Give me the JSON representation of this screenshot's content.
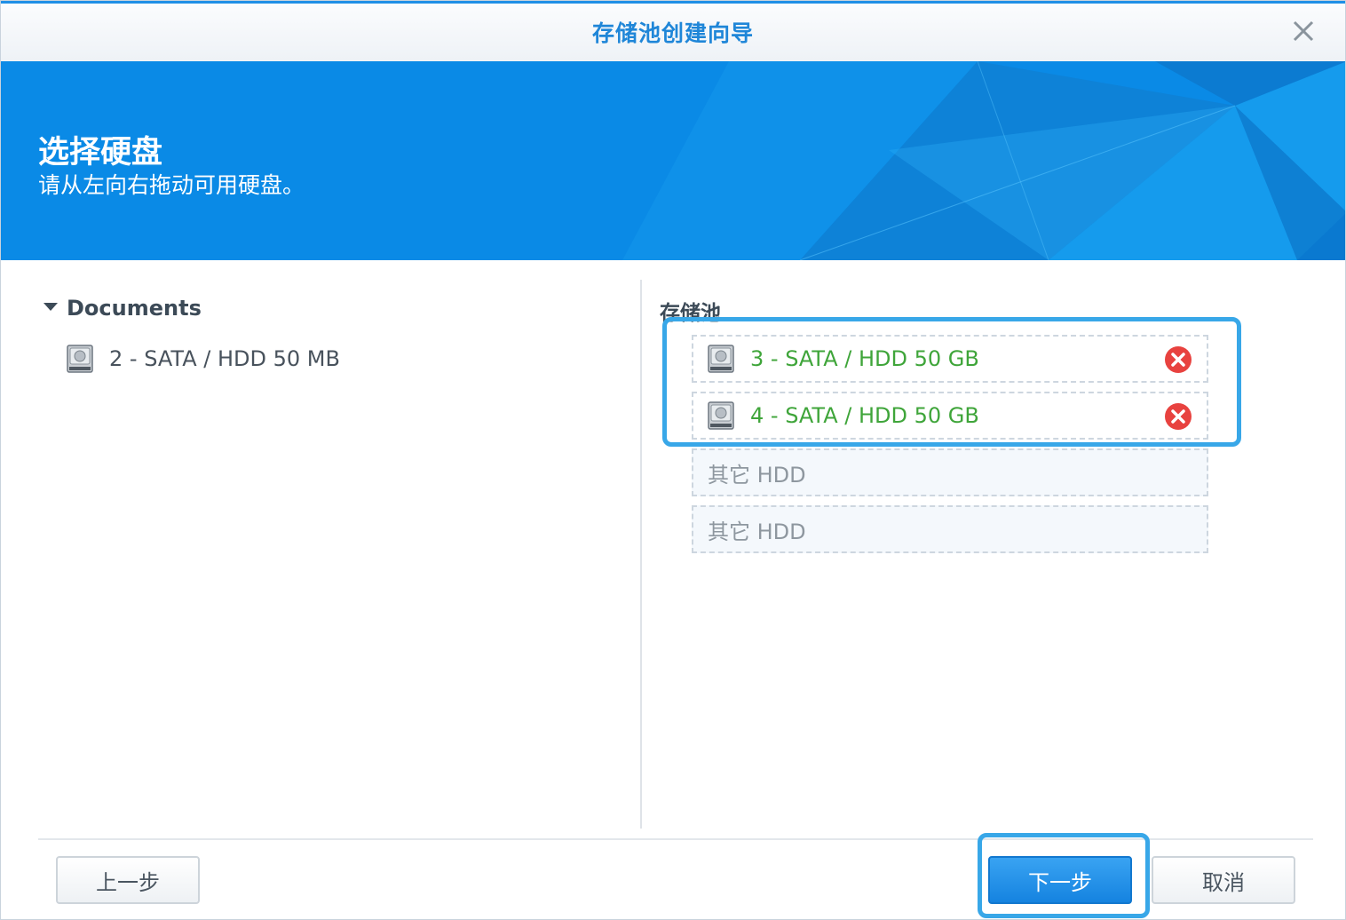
{
  "window": {
    "title": "存储池创建向导"
  },
  "banner": {
    "title": "选择硬盘",
    "subtitle": "请从左向右拖动可用硬盘。"
  },
  "available": {
    "group_name": "Documents",
    "disks": [
      {
        "label": "2 - SATA / HDD 50 MB",
        "icon": "hdd-icon"
      }
    ]
  },
  "pool": {
    "label": "存储池",
    "slots": [
      {
        "label": "3 - SATA / HDD 50 GB",
        "state": "selected",
        "icon": "hdd-icon"
      },
      {
        "label": "4 - SATA / HDD 50 GB",
        "state": "selected",
        "icon": "hdd-icon"
      },
      {
        "label": "其它 HDD",
        "state": "empty"
      },
      {
        "label": "其它 HDD",
        "state": "empty"
      }
    ]
  },
  "footer": {
    "back_label": "上一步",
    "next_label": "下一步",
    "cancel_label": "取消"
  },
  "colors": {
    "accent": "#1f86d8",
    "banner": "#0a8ae6",
    "selected_text": "#3fa53a",
    "remove": "#e8423f"
  }
}
